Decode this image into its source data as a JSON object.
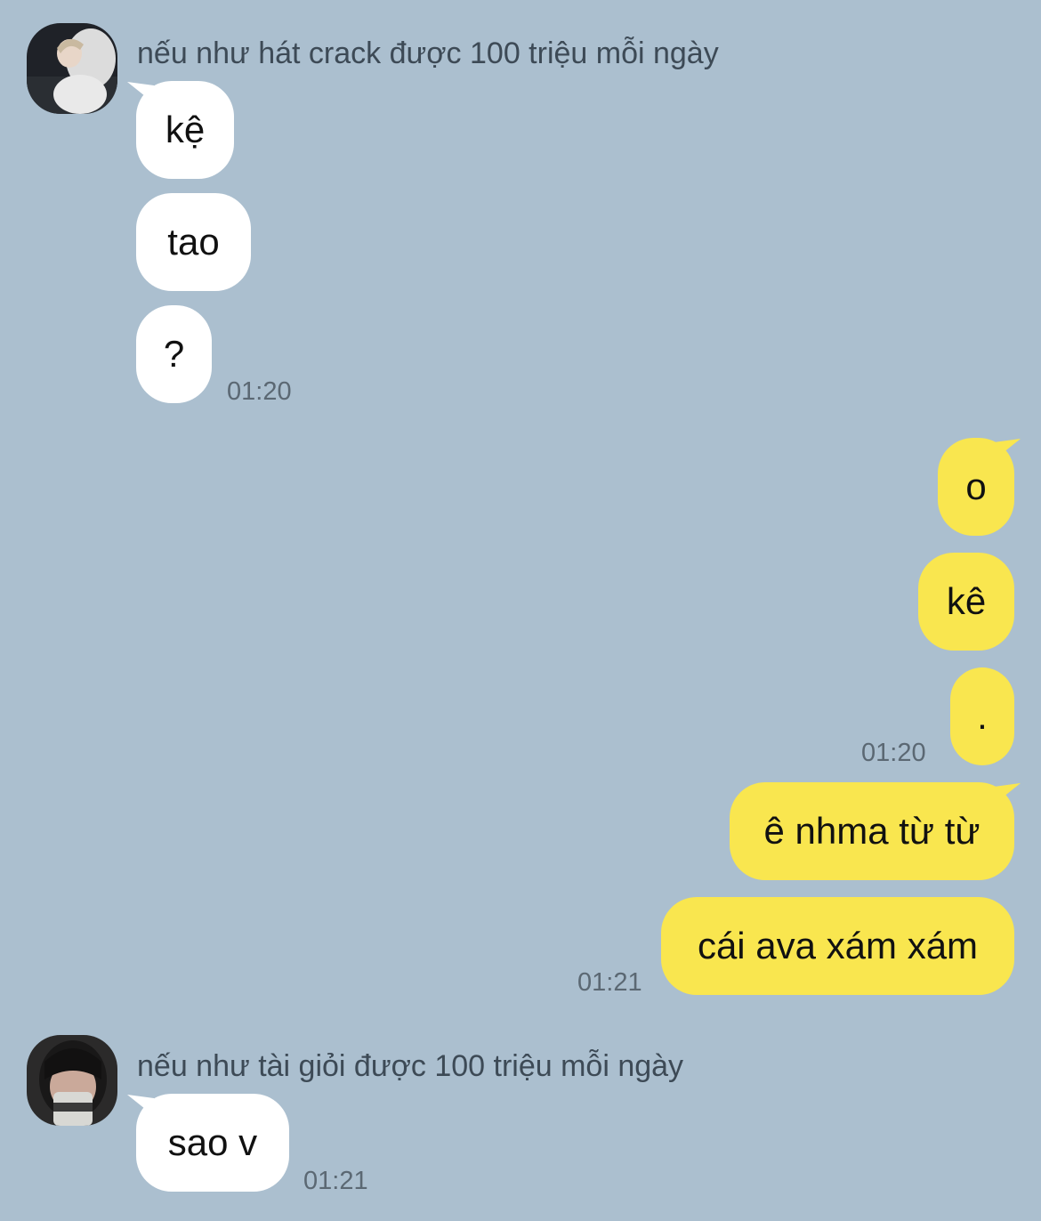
{
  "colors": {
    "background": "#abbfcf",
    "incoming_bubble": "#ffffff",
    "outgoing_bubble": "#f9e64f",
    "timestamp": "#5b6873"
  },
  "chat": {
    "group1": {
      "sender": "nếu như hát crack được 100 triệu mỗi ngày",
      "avatar_icon": "profile-photo-avatar",
      "messages": [
        "kệ",
        "tao",
        "?"
      ],
      "time": "01:20"
    },
    "group2": {
      "messages": [
        "o",
        "kê",
        "."
      ],
      "time": "01:20"
    },
    "group3": {
      "messages": [
        "ê nhma từ từ",
        "cái ava xám xám"
      ],
      "time": "01:21"
    },
    "group4": {
      "sender": "nếu như tài giỏi được 100 triệu mỗi ngày",
      "avatar_icon": "profile-photo-avatar",
      "messages": [
        "sao v"
      ],
      "time": "01:21"
    }
  }
}
